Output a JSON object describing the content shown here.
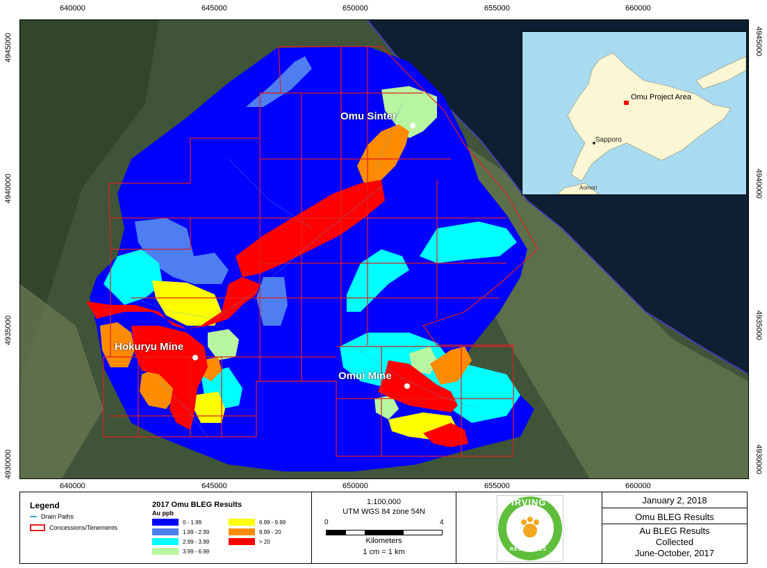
{
  "grid": {
    "x_labels": [
      "640000",
      "645000",
      "650000",
      "655000",
      "660000"
    ],
    "y_labels": [
      "4945000",
      "4940000",
      "4935000",
      "4930000"
    ]
  },
  "places": {
    "omu_sinter": "Omu Sinter",
    "hokuryu": "Hokuryu Mine",
    "omui": "Omui Mine"
  },
  "inset": {
    "project_area": "Omu Project Area",
    "sapporo": "Sapporo",
    "aomori": "Aomori"
  },
  "legend": {
    "title": "Legend",
    "drain": "Drain Paths",
    "concessions": "Concessions/Tenements",
    "results_title": "2017 Omu BLEG Results",
    "unit": "Au ppb",
    "classes": [
      {
        "label": "0 - 1.99",
        "color": "#0000ff"
      },
      {
        "label": "1.99 - 2.99",
        "color": "#4e7ef2"
      },
      {
        "label": "2.99 - 3.99",
        "color": "#00ffff"
      },
      {
        "label": "3.99 - 6.99",
        "color": "#b8f5a0"
      },
      {
        "label": "6.99 - 9.99",
        "color": "#ffff00"
      },
      {
        "label": "9.99 - 20",
        "color": "#ff8c00"
      },
      {
        "label": "> 20",
        "color": "#ff0000"
      }
    ],
    "drain_color": "#3fa7d6",
    "concession_color": "#e0201e"
  },
  "scale": {
    "ratio": "1:100,000",
    "projection": "UTM WGS 84 zone 54N",
    "tick0": "0",
    "tick4": "4",
    "units": "Kilometers",
    "equiv": "1 cm = 1 km"
  },
  "logo": {
    "text": "IRVING",
    "sub": "RESOURCES"
  },
  "titleblock": {
    "date": "January 2, 2018",
    "title": "Omu BLEG Results",
    "line1": "Au BLEG Results",
    "line2": "Collected",
    "line3": "June-October, 2017"
  }
}
